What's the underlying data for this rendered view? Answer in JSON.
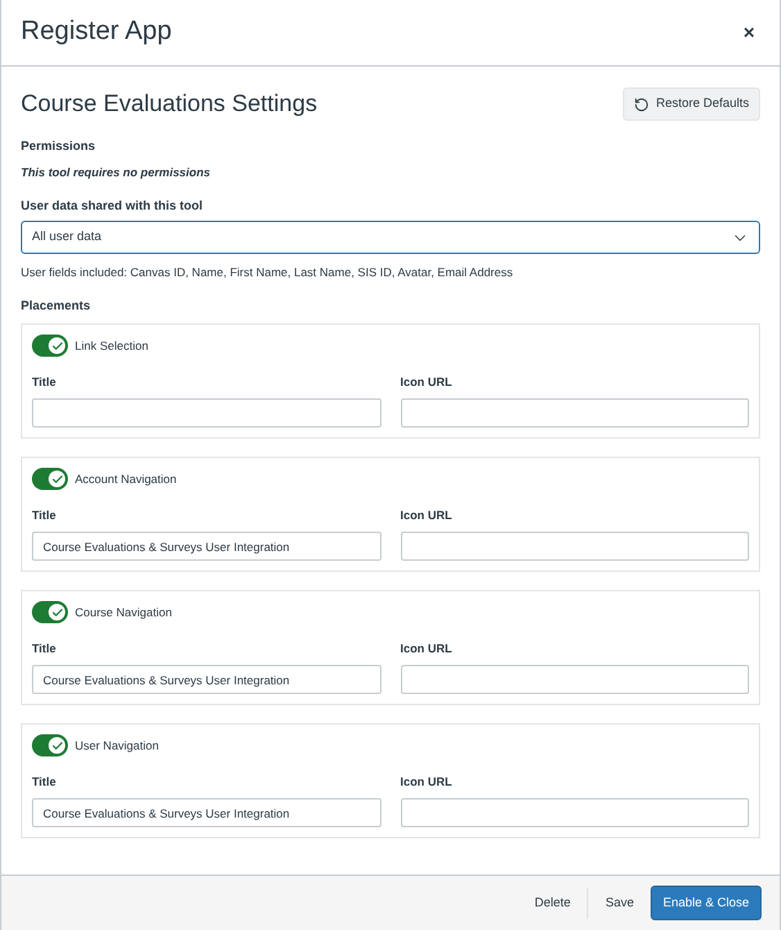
{
  "dialog": {
    "title": "Register App",
    "close": "×"
  },
  "settings": {
    "heading": "Course Evaluations Settings",
    "restore_button": "Restore Defaults"
  },
  "permissions": {
    "label": "Permissions",
    "note": "This tool requires no permissions"
  },
  "user_data": {
    "label": "User data shared with this tool",
    "value": "All user data",
    "fields_note": "User fields included: Canvas ID, Name, First Name, Last Name, SIS ID, Avatar, Email Address"
  },
  "placements": {
    "label": "Placements",
    "items": [
      {
        "name": "Link Selection",
        "on": true,
        "title_label": "Title",
        "icon_label": "Icon URL"
      },
      {
        "name": "Account Navigation",
        "on": true,
        "title_label": "Title",
        "title_value": "Course Evaluations & Surveys User Integration",
        "icon_label": "Icon URL"
      },
      {
        "name": "Course Navigation",
        "on": true,
        "title_label": "Title",
        "title_value": "Course Evaluations & Surveys User Integration",
        "icon_label": "Icon URL"
      },
      {
        "name": "User Navigation",
        "on": true,
        "title_label": "Title",
        "title_value": "Course Evaluations & Surveys User Integration",
        "icon_label": "Icon URL"
      }
    ]
  },
  "footer": {
    "buttons": [
      {
        "label": "Delete",
        "kind": "plain"
      },
      {
        "label": "Save",
        "kind": "plain"
      },
      {
        "label": "Enable & Close",
        "kind": "primary"
      }
    ]
  }
}
